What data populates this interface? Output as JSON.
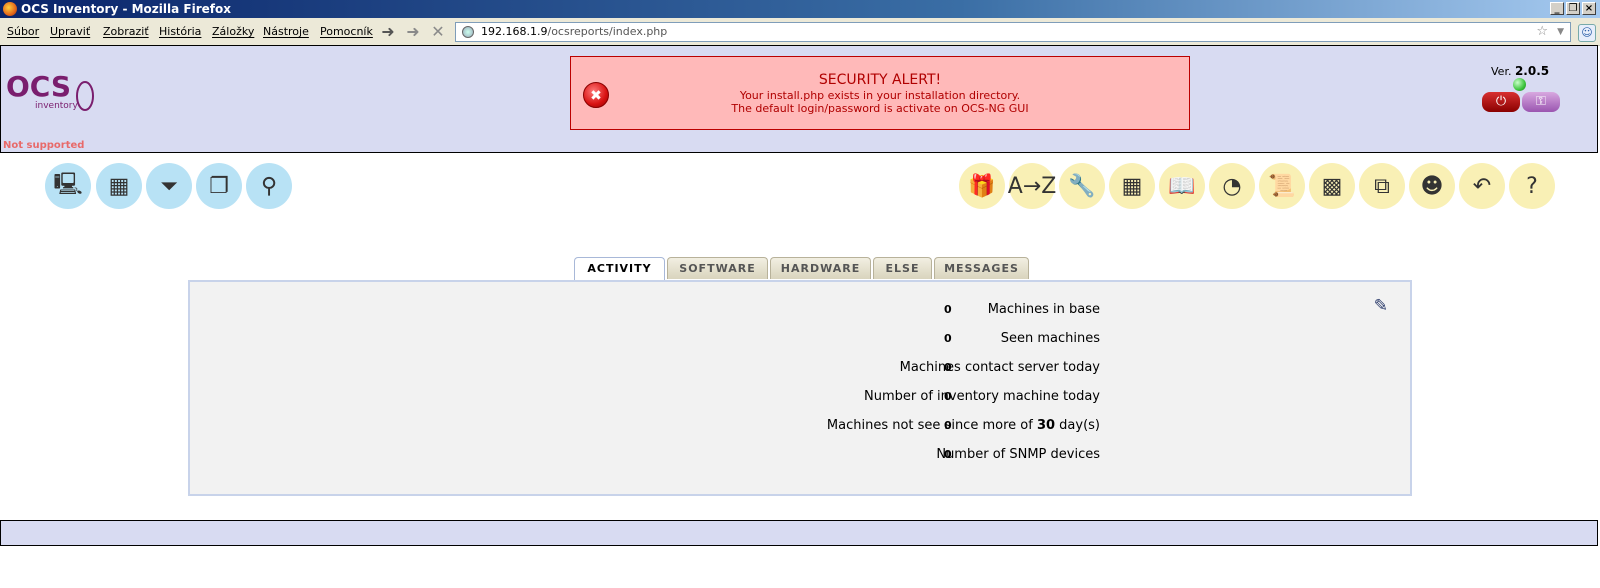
{
  "window": {
    "title": "OCS Inventory - Mozilla Firefox"
  },
  "menubar": {
    "items": [
      "Súbor",
      "Upraviť",
      "Zobraziť",
      "História",
      "Záložky",
      "Nástroje",
      "Pomocník"
    ]
  },
  "urlbar": {
    "host": "192.168.1.9",
    "path": "/ocsreports/index.php"
  },
  "header": {
    "logo_text": "OCS",
    "logo_sub": "inventory",
    "not_supported": "Not supported",
    "version_label": "Ver.",
    "version": "2.0.5"
  },
  "alert": {
    "title": "SECURITY ALERT!",
    "line1": "Your install.php exists in your installation directory.",
    "line2": "The default login/password is activate on OCS-NG GUI"
  },
  "icons_left": [
    "computers-icon",
    "network-icon",
    "filter-icon",
    "windows-icon",
    "search-icon"
  ],
  "icons_right": [
    "deploy-icon",
    "dictionary-icon",
    "config-icon",
    "groups-icon",
    "documentation-icon",
    "stats-icon",
    "logs-icon",
    "firewall-icon",
    "tags-icon",
    "teledeploy-icon",
    "restore-icon",
    "help-icon"
  ],
  "tabs": [
    "ACTIVITY",
    "SOFTWARE",
    "HARDWARE",
    "ELSE",
    "MESSAGES"
  ],
  "activity": {
    "rows": [
      {
        "label": "Machines in base",
        "value": "0"
      },
      {
        "label": "Seen machines",
        "value": "0"
      },
      {
        "label": "Machines contact server today",
        "value": "0"
      },
      {
        "label": "Number of inventory machine today",
        "value": "0"
      },
      {
        "label_pre": "Machines not see since more of ",
        "label_bold": "30",
        "label_post": " day(s)",
        "value": "0"
      },
      {
        "label": "Number of SNMP devices",
        "value": "0"
      }
    ]
  },
  "colors": {
    "header_bg": "#d8dbf2",
    "alert_bg": "#ffb9b9",
    "alert_text": "#b00000"
  }
}
